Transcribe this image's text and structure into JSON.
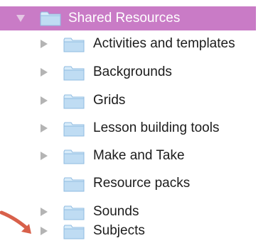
{
  "tree": {
    "root": {
      "label": "Shared Resources",
      "expanded": true,
      "selected": true,
      "icon": "folder-icon",
      "disclosure": "chevron-down-icon"
    },
    "children": [
      {
        "label": "Activities and templates",
        "has_children": true
      },
      {
        "label": "Backgrounds",
        "has_children": true
      },
      {
        "label": "Grids",
        "has_children": true
      },
      {
        "label": "Lesson building tools",
        "has_children": true
      },
      {
        "label": "Make and Take",
        "has_children": true
      },
      {
        "label": "Resource packs",
        "has_children": false
      },
      {
        "label": "Sounds",
        "has_children": true
      },
      {
        "label": "Subjects",
        "has_children": true
      }
    ]
  },
  "colors": {
    "selection": "#c97bc6",
    "disclosure": "#b4b4b4",
    "folder_fill": "#c8e3f6",
    "folder_stroke": "#86b6dc",
    "annotation_arrow": "#d8604a"
  }
}
